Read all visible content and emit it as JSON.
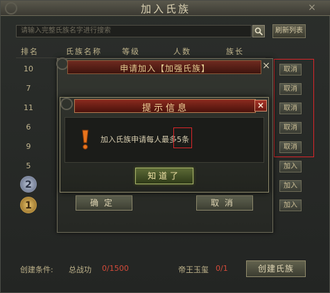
{
  "main": {
    "title": "加入氏族",
    "close_label": "×",
    "search_placeholder": "请输入完整氏族名字进行搜索",
    "refresh_label": "刷新列表",
    "columns": [
      "排名",
      "氏族名称",
      "等级",
      "人数",
      "族长"
    ],
    "ranks": [
      "10",
      "7",
      "11",
      "6",
      "9",
      "5"
    ],
    "badge_ranks": [
      "2",
      "1"
    ],
    "side_buttons": [
      "取消",
      "取消",
      "取消",
      "取消",
      "取消",
      "加入",
      "加入",
      "加入"
    ],
    "create_condition_label": "创建条件:",
    "total_power_label": "总战功",
    "total_power_value": "0/1500",
    "seal_label": "帝王玉玺",
    "seal_value": "0/1",
    "create_button": "创建氏族"
  },
  "apply_dialog": {
    "title": "申请加入【加强氏族】",
    "close_label": "×",
    "confirm_label": "确定",
    "cancel_label": "取消"
  },
  "info_dialog": {
    "title": "提示信息",
    "close_label": "×",
    "message_prefix": "加入氏族申请每人最多",
    "message_highlight": "5条",
    "ok_label": "知道了"
  },
  "colors": {
    "highlight_border": "#d8262a",
    "value_red": "#d24a3a",
    "title_bar_red": "#8a2a1e",
    "warning_orange": "#e8741c"
  },
  "icons": [
    "search-icon",
    "close-icon",
    "warning-icon",
    "rank-badge-icon"
  ]
}
